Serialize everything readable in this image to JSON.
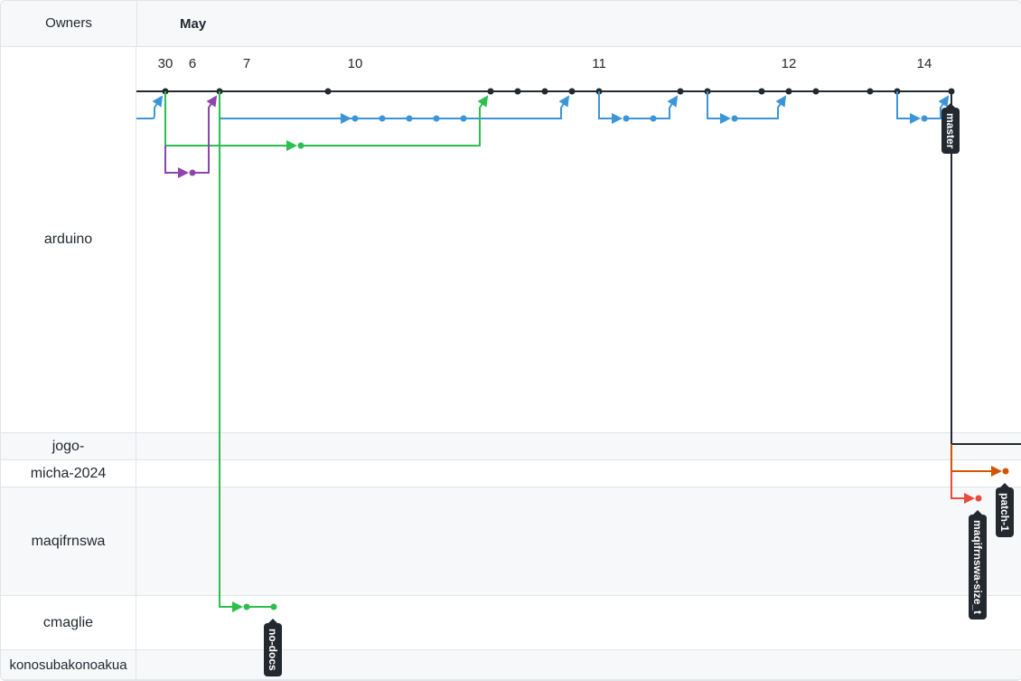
{
  "header": {
    "owners_label": "Owners",
    "month": "May"
  },
  "days": [
    "30",
    "6",
    "7",
    "10",
    "11",
    "12",
    "14"
  ],
  "owners": [
    "arduino",
    "jogo-",
    "micha-2024",
    "maqifrnswa",
    "cmaglie",
    "konosubakonoakua"
  ],
  "branches": [
    "master",
    "no-docs",
    "maqifrnswa-size_t",
    "patch-1"
  ],
  "colors": {
    "master": "#24292f",
    "blue": "#3b95d8",
    "green": "#2cbe4e",
    "purple": "#8e44ad",
    "orange": "#d35400",
    "red": "#e74c3c"
  }
}
